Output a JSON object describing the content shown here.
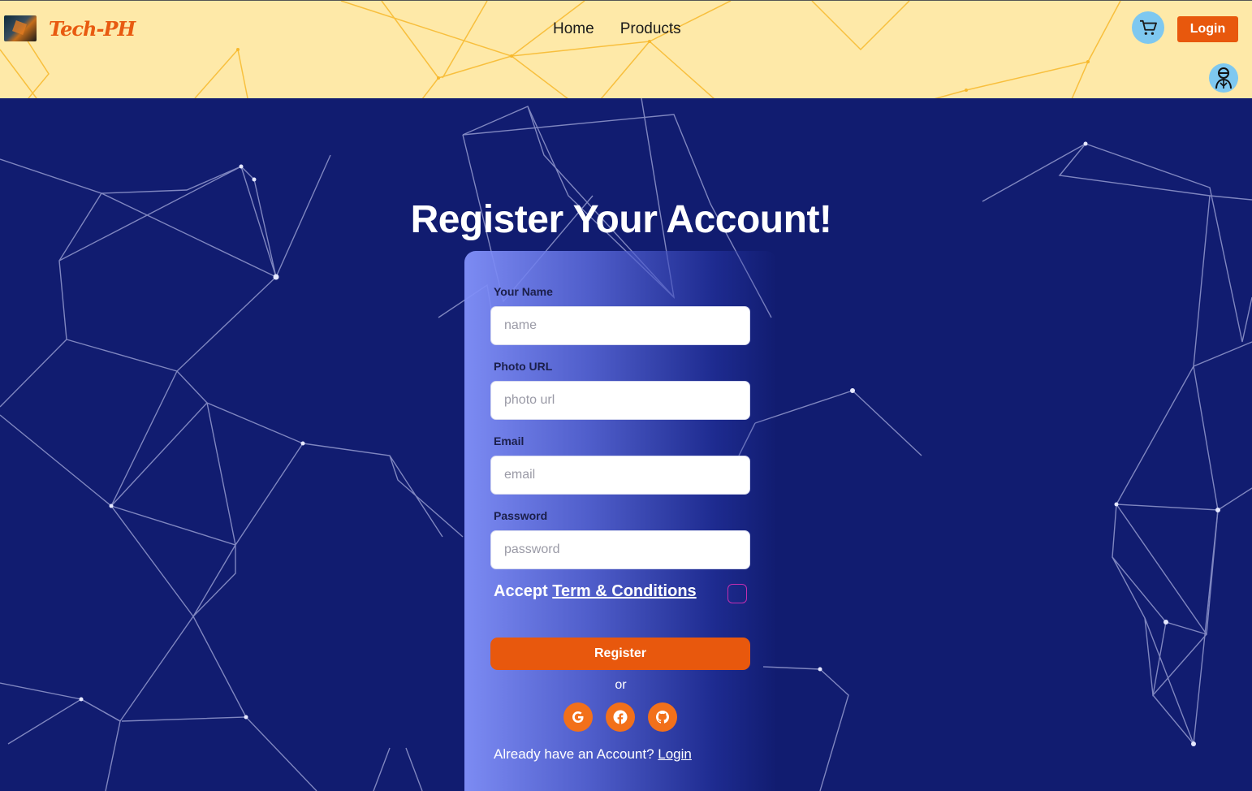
{
  "header": {
    "brand": "Tech-PH",
    "nav": [
      "Home",
      "Products"
    ],
    "login_label": "Login"
  },
  "page": {
    "title": "Register Your Account!"
  },
  "form": {
    "name_label": "Your Name",
    "name_placeholder": "name",
    "photo_label": "Photo URL",
    "photo_placeholder": "photo url",
    "email_label": "Email",
    "email_placeholder": "email",
    "password_label": "Password",
    "password_placeholder": "password",
    "accept_text": "Accept",
    "terms_link": "Term & Conditions",
    "register_label": "Register",
    "or_text": "or",
    "already_text": "Already have an Account?",
    "login_link": "Login"
  },
  "icons": {
    "cart": "cart-icon",
    "avatar": "user-avatar-icon",
    "google": "google-icon",
    "facebook": "facebook-icon",
    "github": "github-icon"
  },
  "colors": {
    "accent": "#e8580d",
    "header_bg": "#fee9a8",
    "main_bg": "#111c70"
  }
}
